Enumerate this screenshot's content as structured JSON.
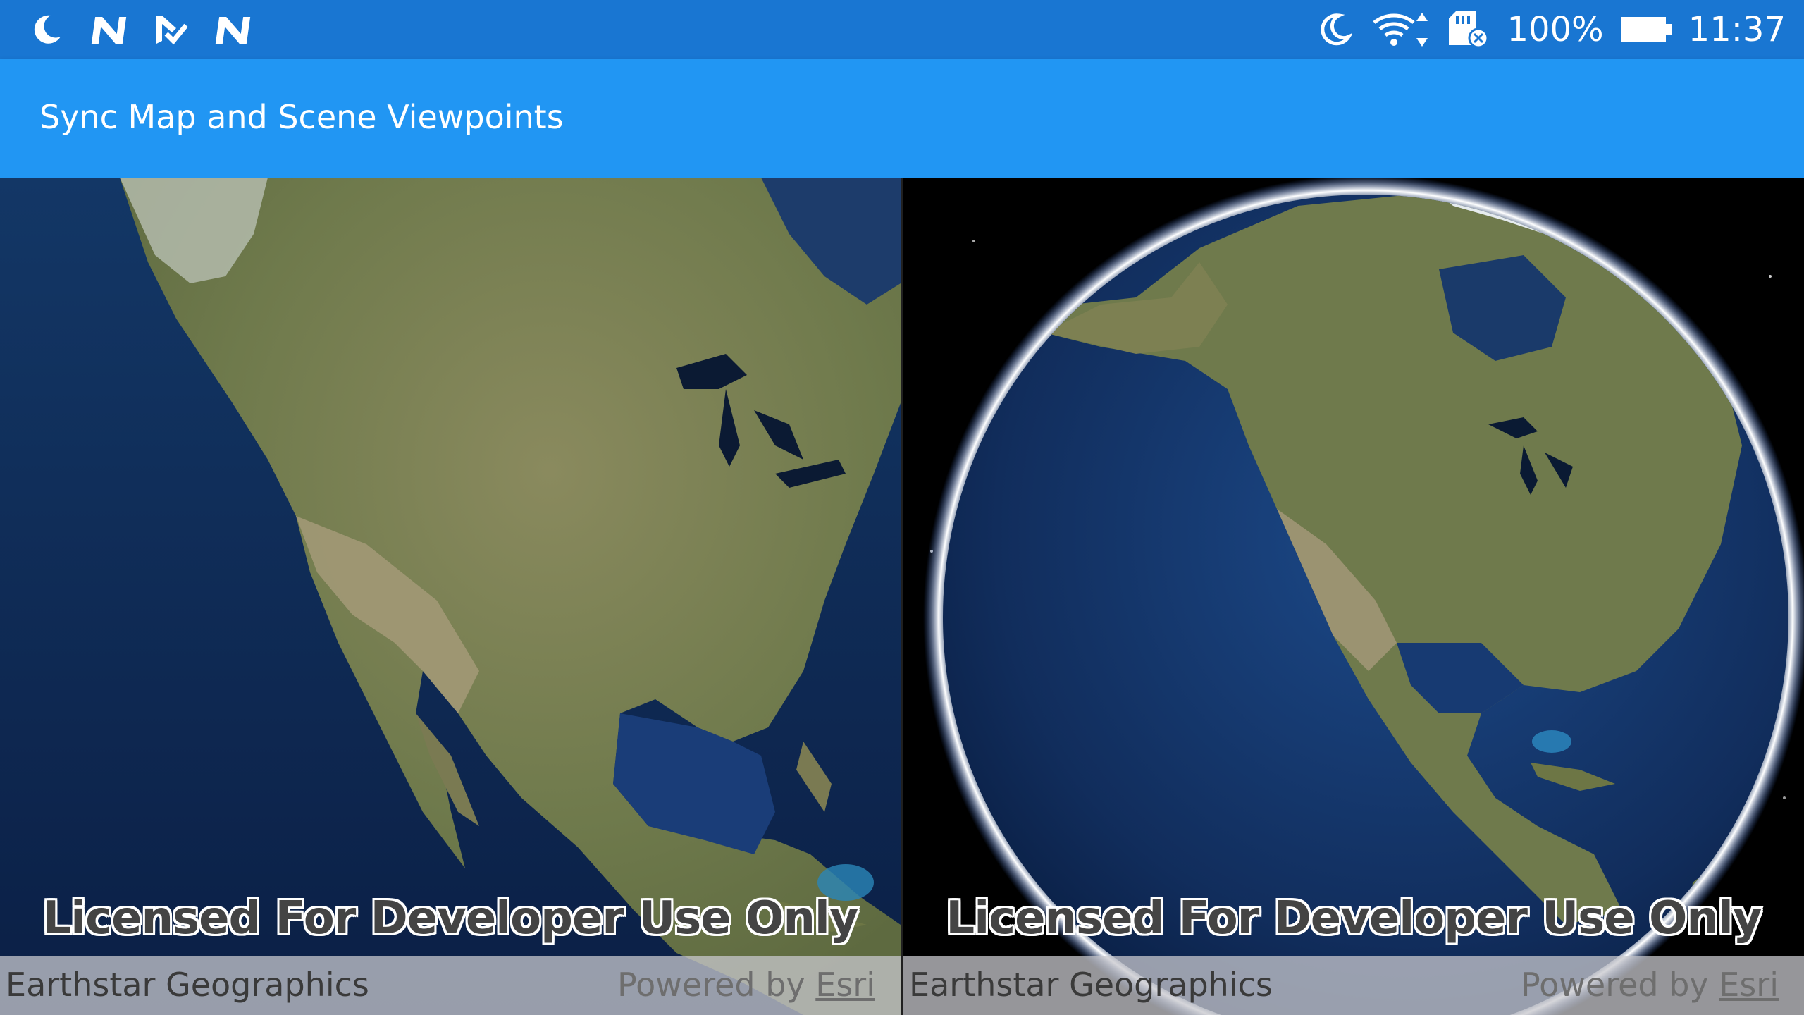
{
  "status_bar": {
    "battery": "100%",
    "time": "11:37",
    "left_icons": [
      "moon-icon",
      "n-icon",
      "checklist-icon",
      "n-icon"
    ],
    "right_icons": [
      "moon-icon",
      "wifi-icon",
      "sd-card-icon",
      "battery-icon"
    ]
  },
  "app_bar": {
    "title": "Sync Map and Scene Viewpoints",
    "color": "#2196F3"
  },
  "map_view": {
    "watermark": "Licensed For Developer Use Only",
    "attribution_source": "Earthstar Geographics",
    "powered_by_prefix": "Powered by ",
    "powered_by_link": "Esri"
  },
  "scene_view": {
    "watermark": "Licensed For Developer Use Only",
    "attribution_source": "Earthstar Geographics",
    "powered_by_prefix": "Powered by ",
    "powered_by_link": "Esri"
  }
}
